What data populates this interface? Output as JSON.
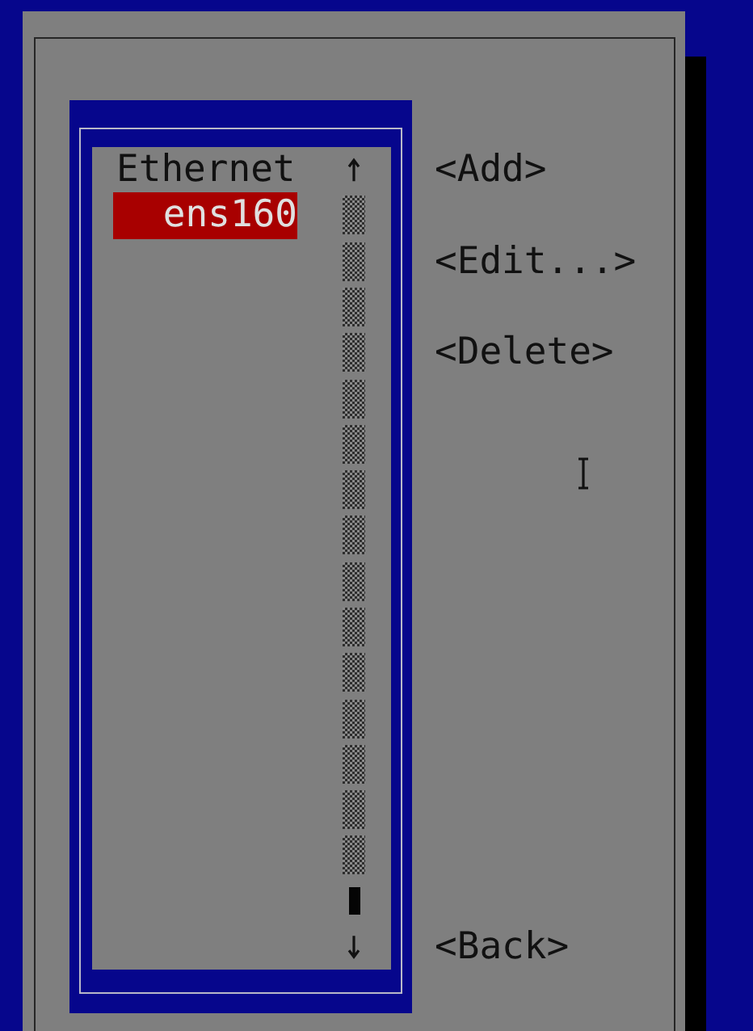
{
  "connection_list": {
    "items": [
      {
        "kind": "header",
        "label": "Ethernet",
        "selected": false
      },
      {
        "kind": "connection",
        "label": "ens160",
        "selected": true
      }
    ]
  },
  "buttons": [
    {
      "label": "<Add>"
    },
    {
      "label": "<Edit...>"
    },
    {
      "label": "<Delete>"
    }
  ],
  "back_button": {
    "label": "<Back>"
  }
}
